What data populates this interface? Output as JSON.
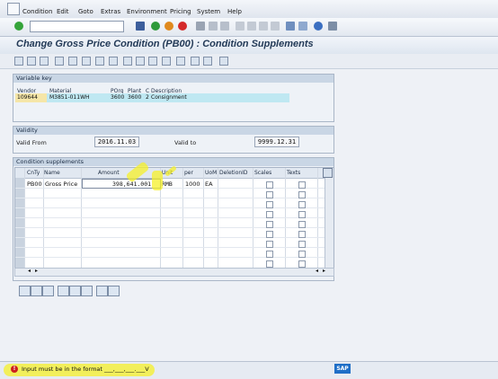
{
  "menu": {
    "items": [
      "Condition",
      "Edit",
      "Goto",
      "Extras",
      "Environment",
      "Pricing",
      "System",
      "Help"
    ]
  },
  "title": "Change Gross Price Condition (PB00) : Condition Supplements",
  "variable_key": {
    "header": "Variable key",
    "columns": [
      "Vendor",
      "Material",
      "POrg",
      "Plant",
      "C",
      "Description"
    ],
    "row": [
      "109644",
      "M3851-011WH",
      "3600",
      "3600",
      "2",
      "Consignment"
    ]
  },
  "validity": {
    "header": "Validity",
    "from_label": "Valid From",
    "from_value": "2016.11.03",
    "to_label": "Valid to",
    "to_value": "9999.12.31"
  },
  "supplements": {
    "header": "Condition supplements",
    "columns": [
      "CnTy",
      "Name",
      "Amount",
      "Unit",
      "per",
      "UoM",
      "DeletionID",
      "Scales",
      "Texts"
    ],
    "row": {
      "cnty": "PB00",
      "name": "Gross Price",
      "amount": "398,641.001",
      "unit": "RMB",
      "per": "1000",
      "uom": "EA"
    }
  },
  "status": {
    "message": "Input must be in the format ___,___,___.___V",
    "type": "error"
  },
  "colors": {
    "title_text": "#233a57",
    "frame_header": "#c9d6e5",
    "key_row_highlight": "#bfe8f2",
    "highlighter": "#f5f028",
    "error_icon": "#cc1f1f"
  }
}
